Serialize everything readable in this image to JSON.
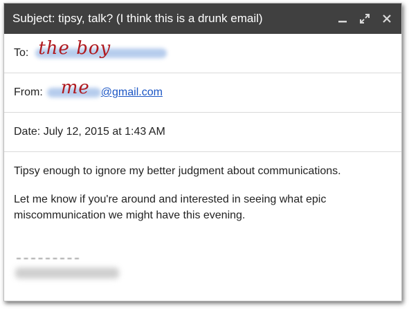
{
  "email": {
    "subject": "Subject: tipsy, talk? (I think this is a drunk email)",
    "to_label": "To:",
    "to_handwritten": "the boy",
    "from_label": "From:",
    "from_handwritten": "me",
    "from_domain": "@gmail.com",
    "date": "Date: July 12, 2015 at 1:43 AM",
    "body_paragraphs": [
      "Tipsy enough to ignore my better judgment about communications.",
      "Let me know if you're around and interested in seeing what epic miscommunication we might have this evening."
    ]
  },
  "window_controls": [
    "minimize-icon",
    "expand-icon",
    "close-icon"
  ],
  "colors": {
    "titlebar": "#404040",
    "handwriting": "#b0191e",
    "link": "#1a55c4",
    "redacted": "#aac4ea"
  }
}
